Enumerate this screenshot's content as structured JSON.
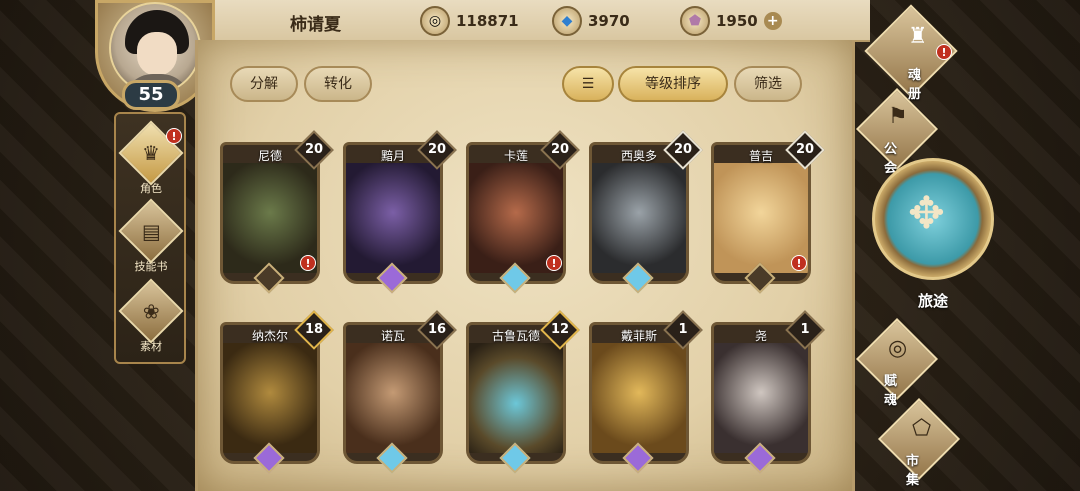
{
  "player": {
    "name": "柿请夏",
    "level": "55"
  },
  "currencies": [
    {
      "icon": "gold-coin-icon",
      "value": "118871"
    },
    {
      "icon": "blue-crystal-icon",
      "value": "3970"
    },
    {
      "icon": "pink-gem-icon",
      "value": "1950"
    }
  ],
  "left_nav": [
    {
      "label": "角色",
      "icon": "character-icon",
      "alert": "!"
    },
    {
      "label": "技能书",
      "icon": "skill-book-icon"
    },
    {
      "label": "素材",
      "icon": "material-icon"
    }
  ],
  "filters": {
    "decompose": "分解",
    "convert": "转化",
    "sort_icon": "sort-icon",
    "sort_level": "等级排序",
    "filter": "筛选"
  },
  "cards": [
    {
      "name": "尼德",
      "level": "20",
      "frame": "dark",
      "gem": "none",
      "alert": "!"
    },
    {
      "name": "黯月",
      "level": "20",
      "frame": "dark",
      "gem": "purple"
    },
    {
      "name": "卡莲",
      "level": "20",
      "frame": "dark",
      "gem": "blue",
      "alert": "!"
    },
    {
      "name": "西奥多",
      "level": "20",
      "frame": "white",
      "gem": "blue"
    },
    {
      "name": "普吉",
      "level": "20",
      "frame": "white",
      "gem": "none",
      "alert": "!"
    },
    {
      "name": "纳杰尔",
      "level": "18",
      "frame": "gold",
      "gem": "purple"
    },
    {
      "name": "诺瓦",
      "level": "16",
      "frame": "dark",
      "gem": "blue"
    },
    {
      "name": "古鲁瓦德",
      "level": "12",
      "frame": "gold",
      "gem": "blue"
    },
    {
      "name": "戴菲斯",
      "level": "1",
      "frame": "dark",
      "gem": "purple"
    },
    {
      "name": "尧",
      "level": "1",
      "frame": "dark",
      "gem": "purple"
    }
  ],
  "right_nav": {
    "soul_book": "魂册",
    "guild": "公会",
    "journey": "旅途",
    "endow": "赋魂",
    "market": "市集",
    "soul_alert": "!"
  },
  "colors": {
    "accent": "#c8a766",
    "parchment": "#e8d9b6",
    "alert": "#c0301f"
  }
}
